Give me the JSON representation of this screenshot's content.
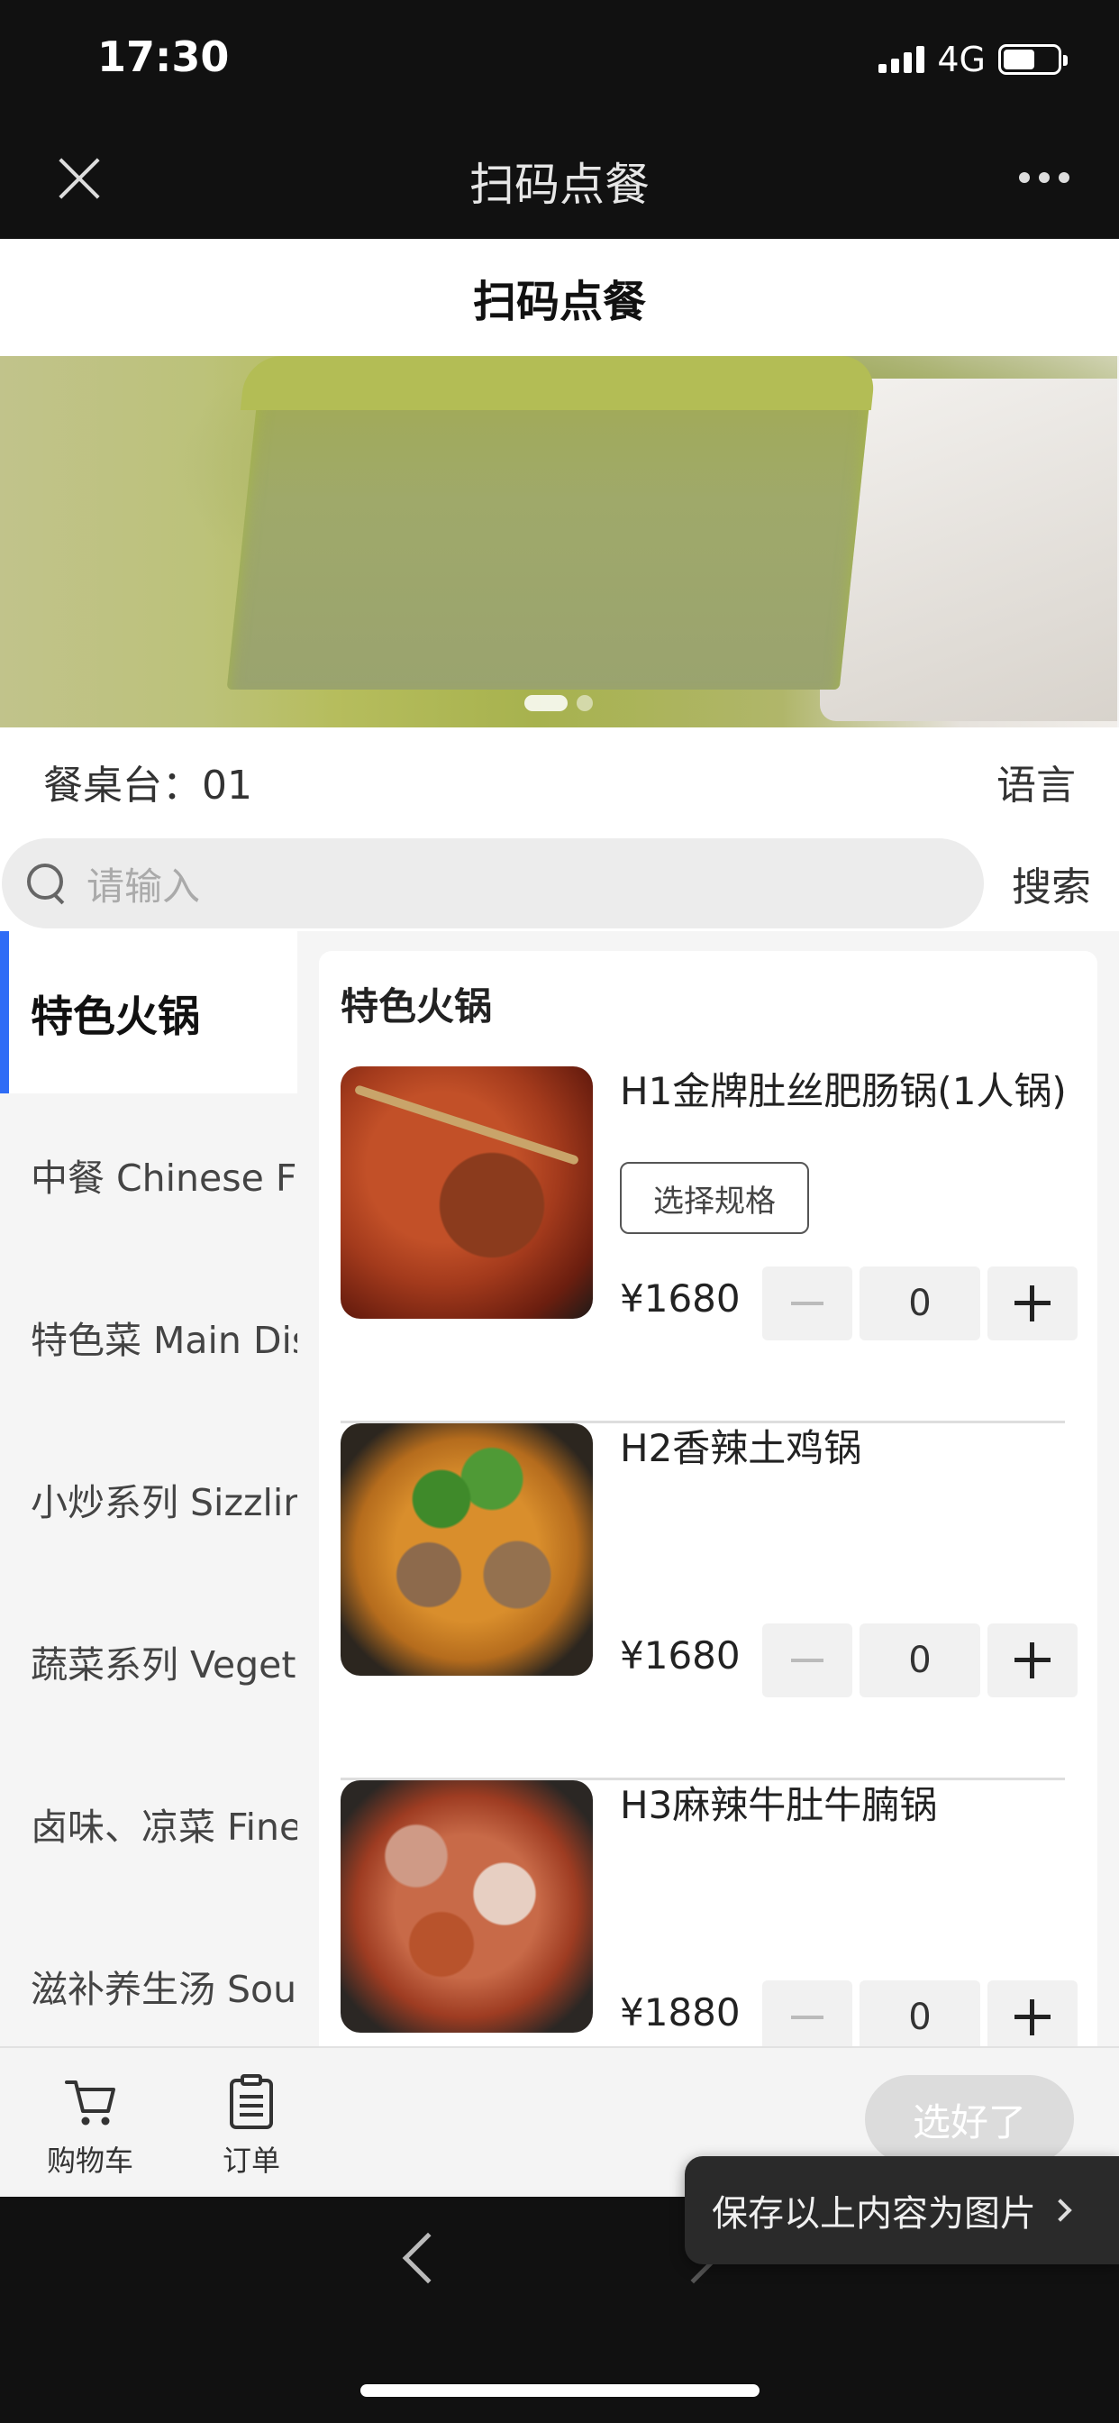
{
  "status_bar": {
    "time": "17:30",
    "network": "4G"
  },
  "nav": {
    "title": "扫码点餐"
  },
  "page": {
    "header_title": "扫码点餐",
    "table_label": "餐桌台：01",
    "language_label": "语言",
    "search": {
      "placeholder": "请输入",
      "button_label": "搜索"
    }
  },
  "sidebar": {
    "categories": [
      {
        "label": "特色火锅",
        "active": true
      },
      {
        "label": "中餐 Chinese Food"
      },
      {
        "label": "特色菜 Main Dishes"
      },
      {
        "label": "小炒系列 Sizzling"
      },
      {
        "label": "蔬菜系列 Vegetables"
      },
      {
        "label": "卤味、凉菜 Fine"
      },
      {
        "label": "滋补养生汤 Soup"
      }
    ]
  },
  "menu": {
    "section_title": "特色火锅",
    "items": [
      {
        "name": "H1金牌肚丝肥肠锅(1人锅)",
        "spec_label": "选择规格",
        "price": "¥1680",
        "qty": "0"
      },
      {
        "name": "H2香辣土鸡锅",
        "price": "¥1680",
        "qty": "0"
      },
      {
        "name": "H3麻辣牛肚牛腩锅",
        "price": "¥1880",
        "qty": "0"
      }
    ]
  },
  "bottom_bar": {
    "cart_label": "购物车",
    "order_label": "订单",
    "done_label": "选好了"
  },
  "toast": {
    "label": "保存以上内容为图片"
  },
  "colors": {
    "accent": "#2f6cf6",
    "nav_bg": "#111111"
  }
}
